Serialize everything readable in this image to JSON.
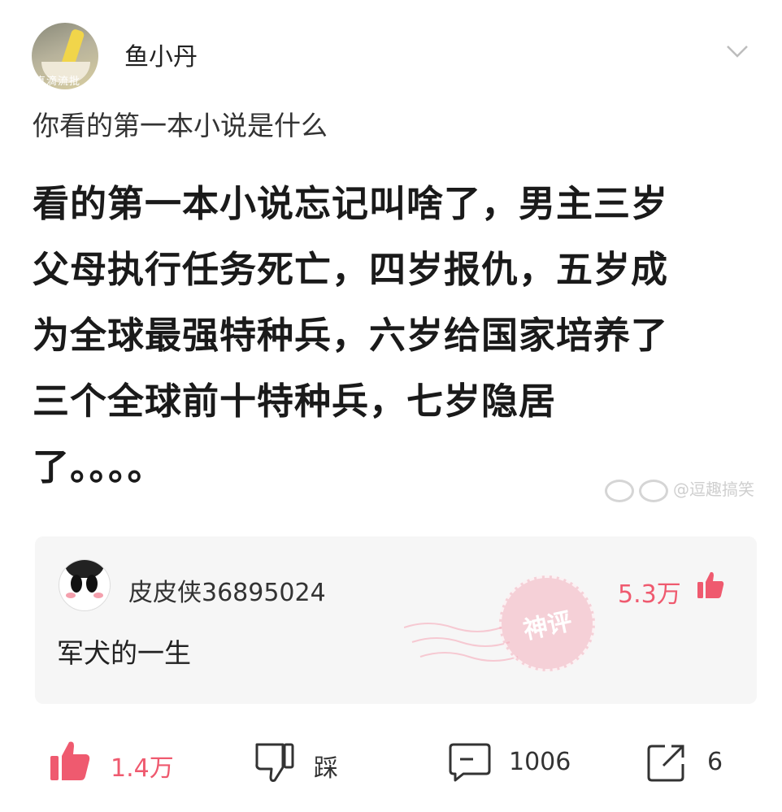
{
  "post": {
    "author": "鱼小丹",
    "avatar_watermark": "真滴流批",
    "question": "你看的第一本小说是什么",
    "body_lines": [
      "看的第一本小说忘记叫啥了，男主三岁",
      "父母执行任务死亡，四岁报仇，五岁成",
      "为全球最强特种兵，六岁给国家培养了",
      "三个全球前十特种兵，七岁隐居",
      "了。。。。"
    ],
    "image_watermark": "@逗趣搞笑"
  },
  "hot_comment": {
    "user": "皮皮侠36895024",
    "text": "军犬的一生",
    "badge": "神评",
    "likes": "5.3万"
  },
  "actions": {
    "like_count": "1.4万",
    "dislike_label": "踩",
    "comment_count": "1006",
    "share_count": "6"
  },
  "colors": {
    "accent": "#ef5a6f",
    "card_bg": "#f6f6f6"
  },
  "icons": [
    "chevron-down-icon",
    "thumbs-up-icon",
    "thumbs-down-icon",
    "comment-icon",
    "share-icon"
  ]
}
